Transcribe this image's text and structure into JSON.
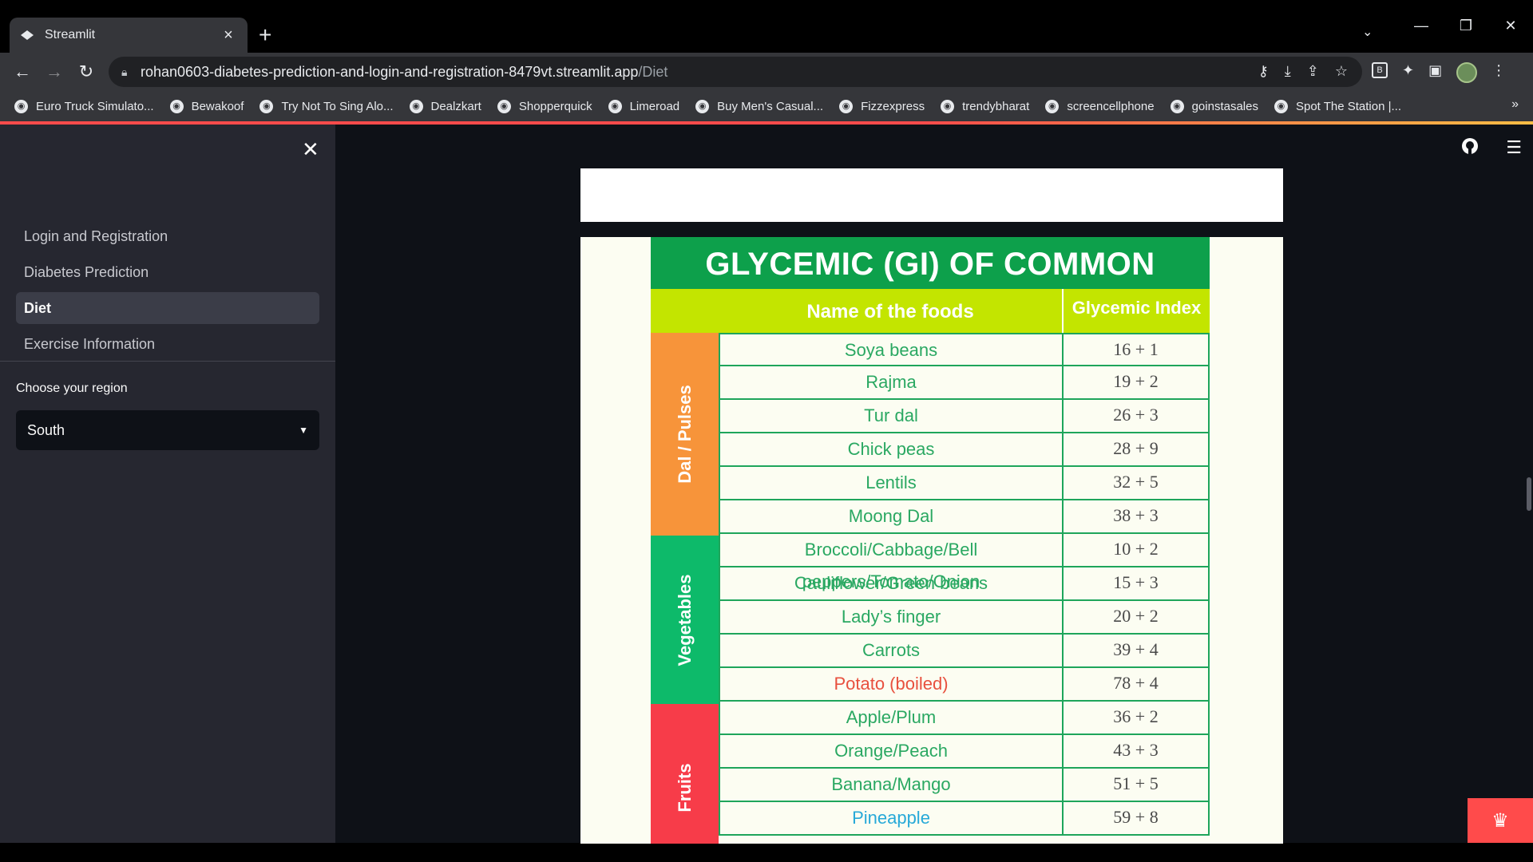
{
  "browser": {
    "tab_title": "Streamlit",
    "url_host": "rohan0603-diabetes-prediction-and-login-and-registration-8479vt.streamlit.app",
    "url_path": "/Diet",
    "bookmarks": [
      "Euro Truck Simulato...",
      "Bewakoof",
      "Try Not To Sing Alo...",
      "Dealzkart",
      "Shopperquick",
      "Limeroad",
      "Buy Men's Casual...",
      "Fizzexpress",
      "trendybharat",
      "screencellphone",
      "goinstasales",
      "Spot The Station |..."
    ]
  },
  "sidebar": {
    "nav": [
      "Login and Registration",
      "Diabetes Prediction",
      "Diet",
      "Exercise Information"
    ],
    "active_index": 2,
    "region_label": "Choose your region",
    "region_value": "South"
  },
  "poster": {
    "title": "GLYCEMIC (GI) OF COMMON FOODS",
    "col_food": "Name of the foods",
    "col_gi": "Glycemic Index",
    "categories": [
      {
        "name": "Dal / Pulses",
        "color": "#f7943a",
        "rows": 6
      },
      {
        "name": "Vegetables",
        "color": "#0dba6a",
        "rows": 5
      },
      {
        "name": "Fruits",
        "color": "#f73c49",
        "rows": 4
      }
    ],
    "rows": [
      {
        "food": "Soya beans",
        "gi": "16 + 1",
        "color": "#2aa862"
      },
      {
        "food": "Rajma",
        "gi": "19 + 2",
        "color": "#2aa862"
      },
      {
        "food": "Tur dal",
        "gi": "26 + 3",
        "color": "#2aa862"
      },
      {
        "food": "Chick peas",
        "gi": "28 + 9",
        "color": "#2aa862"
      },
      {
        "food": "Lentils",
        "gi": "32 + 5",
        "color": "#2aa862"
      },
      {
        "food": "Moong Dal",
        "gi": "38 + 3",
        "color": "#2aa862"
      },
      {
        "food": "Broccoli/Cabbage/Bell peppers/Tomato/Onion",
        "gi": "10 + 2",
        "color": "#2aa862"
      },
      {
        "food": "Cauliflower/Green beans",
        "gi": "15 + 3",
        "color": "#2aa862"
      },
      {
        "food": "Lady’s finger",
        "gi": "20 + 2",
        "color": "#2aa862"
      },
      {
        "food": "Carrots",
        "gi": "39 + 4",
        "color": "#2aa862"
      },
      {
        "food": "Potato (boiled)",
        "gi": "78 + 4",
        "color": "#e8503e"
      },
      {
        "food": "Apple/Plum",
        "gi": "36 + 2",
        "color": "#2aa862"
      },
      {
        "food": "Orange/Peach",
        "gi": "43 + 3",
        "color": "#2aa862"
      },
      {
        "food": "Banana/Mango",
        "gi": "51 + 5",
        "color": "#2aa862"
      },
      {
        "food": "Pineapple",
        "gi": "59 + 8",
        "color": "#27a9d8"
      }
    ]
  }
}
